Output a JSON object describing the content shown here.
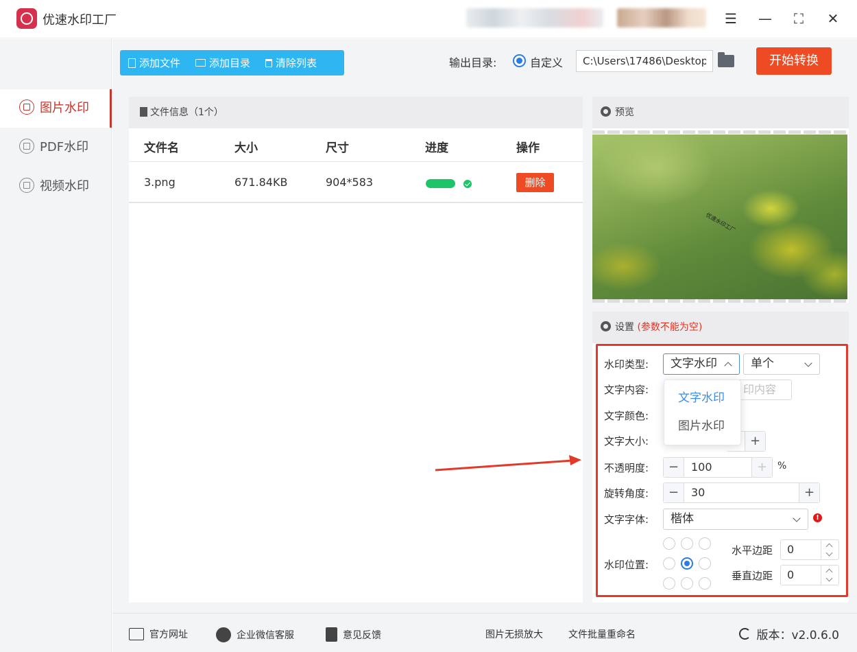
{
  "titlebar": {
    "app_name": "优速水印工厂",
    "menu_glyph": "☰",
    "minimize_glyph": "—",
    "maximize_glyph": "⛶",
    "close_glyph": "✕"
  },
  "sidebar": {
    "items": [
      {
        "label": "图片水印",
        "active": true
      },
      {
        "label": "PDF水印",
        "active": false
      },
      {
        "label": "视频水印",
        "active": false
      }
    ]
  },
  "toolbar": {
    "add_file": "添加文件",
    "add_dir": "添加目录",
    "clear_list": "清除列表",
    "output_label": "输出目录:",
    "output_option": "自定义",
    "output_path": "C:\\Users\\17486\\Desktop",
    "start_button": "开始转换"
  },
  "file_panel": {
    "header": "文件信息（1个）",
    "columns": [
      "文件名",
      "大小",
      "尺寸",
      "进度",
      "操作"
    ],
    "rows": [
      {
        "name": "3.png",
        "size": "671.84KB",
        "dimensions": "904*583",
        "progress_percent": 100,
        "action": "删除"
      }
    ]
  },
  "preview": {
    "header": "预览",
    "watermark_text": "优速水印工厂"
  },
  "settings": {
    "header": "设置",
    "warning": "(参数不能为空)",
    "type_label": "水印类型:",
    "type_value": "文字水印",
    "mode_value": "单个",
    "content_label": "文字内容:",
    "content_placeholder": "印内容",
    "color_label": "文字颜色:",
    "size_label": "文字大小:",
    "opacity_label": "不透明度:",
    "opacity_value": "100",
    "opacity_unit": "%",
    "rotation_label": "旋转角度:",
    "rotation_value": "30",
    "font_label": "文字字体:",
    "font_value": "楷体",
    "position_label": "水印位置:",
    "h_margin_label": "水平边距",
    "h_margin_value": "0",
    "v_margin_label": "垂直边距",
    "v_margin_value": "0",
    "minus": "−",
    "plus": "+",
    "error_glyph": "!"
  },
  "dropdown": {
    "options": [
      "文字水印",
      "图片水印"
    ],
    "selected": "文字水印"
  },
  "footer": {
    "website": "官方网址",
    "wechat": "企业微信客服",
    "feedback": "意见反馈",
    "upscale": "图片无损放大",
    "rename": "文件批量重命名",
    "version": "版本：v2.0.6.0"
  },
  "colors": {
    "accent_red": "#ee4b24",
    "toolbar_blue": "#2eb6f3",
    "radio_blue": "#2a7de1",
    "progress_green": "#1dc46a",
    "highlight_box": "#e23a2a"
  }
}
